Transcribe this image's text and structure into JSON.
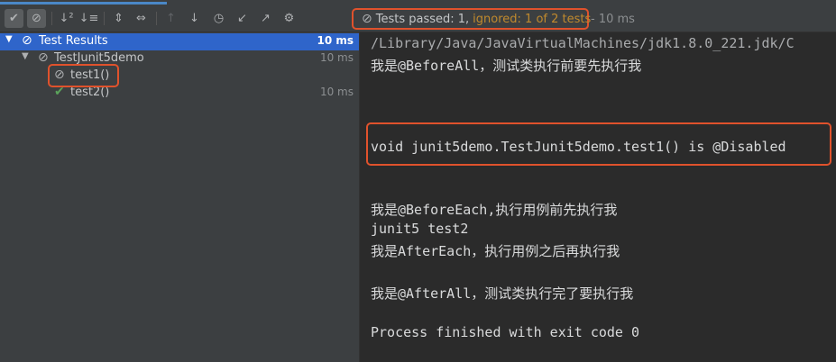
{
  "toolbar": {
    "buttons": [
      {
        "name": "show-passed-toggle",
        "icon": "checkmark-icon",
        "glyph": "✔"
      },
      {
        "name": "show-ignored-toggle",
        "icon": "ignored-icon",
        "glyph": "⊘"
      },
      {
        "name": "sort-alpha-button",
        "icon": "sort-alpha-icon",
        "glyph": "↓²"
      },
      {
        "name": "sort-duration-button",
        "icon": "sort-duration-icon",
        "glyph": "↓≡"
      },
      {
        "name": "expand-all-button",
        "icon": "expand-all-icon",
        "glyph": "⇕"
      },
      {
        "name": "collapse-all-button",
        "icon": "collapse-all-icon",
        "glyph": "⇔"
      },
      {
        "name": "previous-failed-button",
        "icon": "arrow-up-icon",
        "glyph": "↑"
      },
      {
        "name": "next-failed-button",
        "icon": "arrow-down-icon",
        "glyph": "↓"
      },
      {
        "name": "test-history-button",
        "icon": "clock-icon",
        "glyph": "◷"
      },
      {
        "name": "import-tests-button",
        "icon": "import-icon",
        "glyph": "↙"
      },
      {
        "name": "export-tests-button",
        "icon": "export-icon",
        "glyph": "↗"
      },
      {
        "name": "settings-button",
        "icon": "gear-icon",
        "glyph": "⚙"
      }
    ]
  },
  "status": {
    "icon": "ignored-icon",
    "passed": "Tests passed: 1,",
    "ignored": "ignored: 1 of 2 tests",
    "time": "- 10 ms"
  },
  "tree": {
    "root": {
      "label": "Test Results",
      "time": "10 ms"
    },
    "suite": {
      "label": "TestJunit5demo",
      "time": "10 ms"
    },
    "tests": [
      {
        "label": "test1()",
        "time": "",
        "status": "ignored"
      },
      {
        "label": "test2()",
        "time": "10 ms",
        "status": "passed"
      }
    ]
  },
  "console": {
    "lines": [
      "/Library/Java/JavaVirtualMachines/jdk1.8.0_221.jdk/C",
      "我是@BeforeAll，测试类执行前要先执行我",
      "void junit5demo.TestJunit5demo.test1() is @Disabled",
      "我是@BeforeEach,执行用例前先执行我",
      "junit5 test2",
      "我是AfterEach，执行用例之后再执行我",
      "我是@AfterAll，测试类执行完了要执行我",
      "Process finished with exit code 0"
    ]
  },
  "colors": {
    "selection": "#2f65ca",
    "highlight_border": "#e0522c",
    "passed_green": "#5ba35b",
    "ignored_orange": "#c08a2e"
  }
}
